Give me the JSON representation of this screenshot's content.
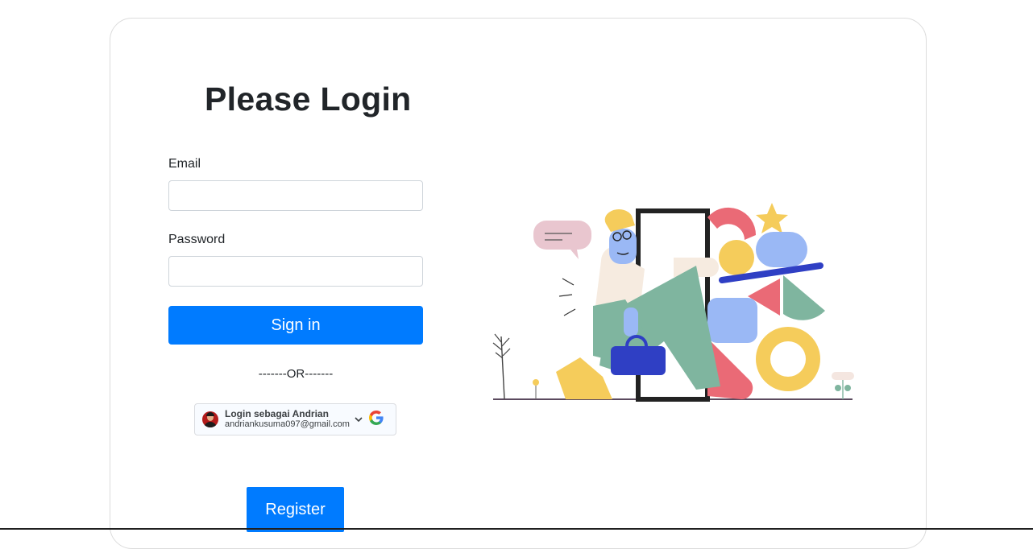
{
  "page": {
    "title": "Please Login"
  },
  "form": {
    "email_label": "Email",
    "email_value": "",
    "password_label": "Password",
    "password_value": "",
    "signin_label": "Sign in",
    "or_text": "-------OR-------",
    "register_label": "Register"
  },
  "google": {
    "name_line": "Login sebagai Andrian",
    "email_line": "andriankusuma097@gmail.com",
    "icons": [
      "avatar",
      "chevron-down-icon",
      "google-logo-icon"
    ]
  },
  "colors": {
    "primary": "#007bff",
    "text": "#212529",
    "border": "#ced4da"
  }
}
